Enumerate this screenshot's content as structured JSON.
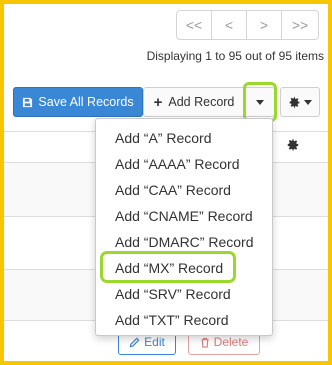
{
  "pagination": {
    "first": "<<",
    "prev": "<",
    "next": ">",
    "last": ">>",
    "summary": "Displaying 1 to 95 out of 95 items"
  },
  "toolbar": {
    "save_all_label": "Save All Records",
    "add_record_label": "Add Record"
  },
  "add_menu": {
    "items": [
      {
        "label": "Add “A” Record"
      },
      {
        "label": "Add “AAAA” Record"
      },
      {
        "label": "Add “CAA” Record"
      },
      {
        "label": "Add “CNAME” Record"
      },
      {
        "label": "Add “DMARC” Record"
      },
      {
        "label": "Add “MX” Record"
      },
      {
        "label": "Add “SRV” Record"
      },
      {
        "label": "Add “TXT” Record"
      }
    ],
    "highlighted_item": "Add “MX” Record"
  },
  "row_actions": {
    "edit_label": "Edit",
    "delete_label": "Delete"
  },
  "colors": {
    "frame": "#f7c600",
    "primary": "#3a87d6",
    "highlight": "#9bd72c",
    "danger": "#e07a7a"
  }
}
